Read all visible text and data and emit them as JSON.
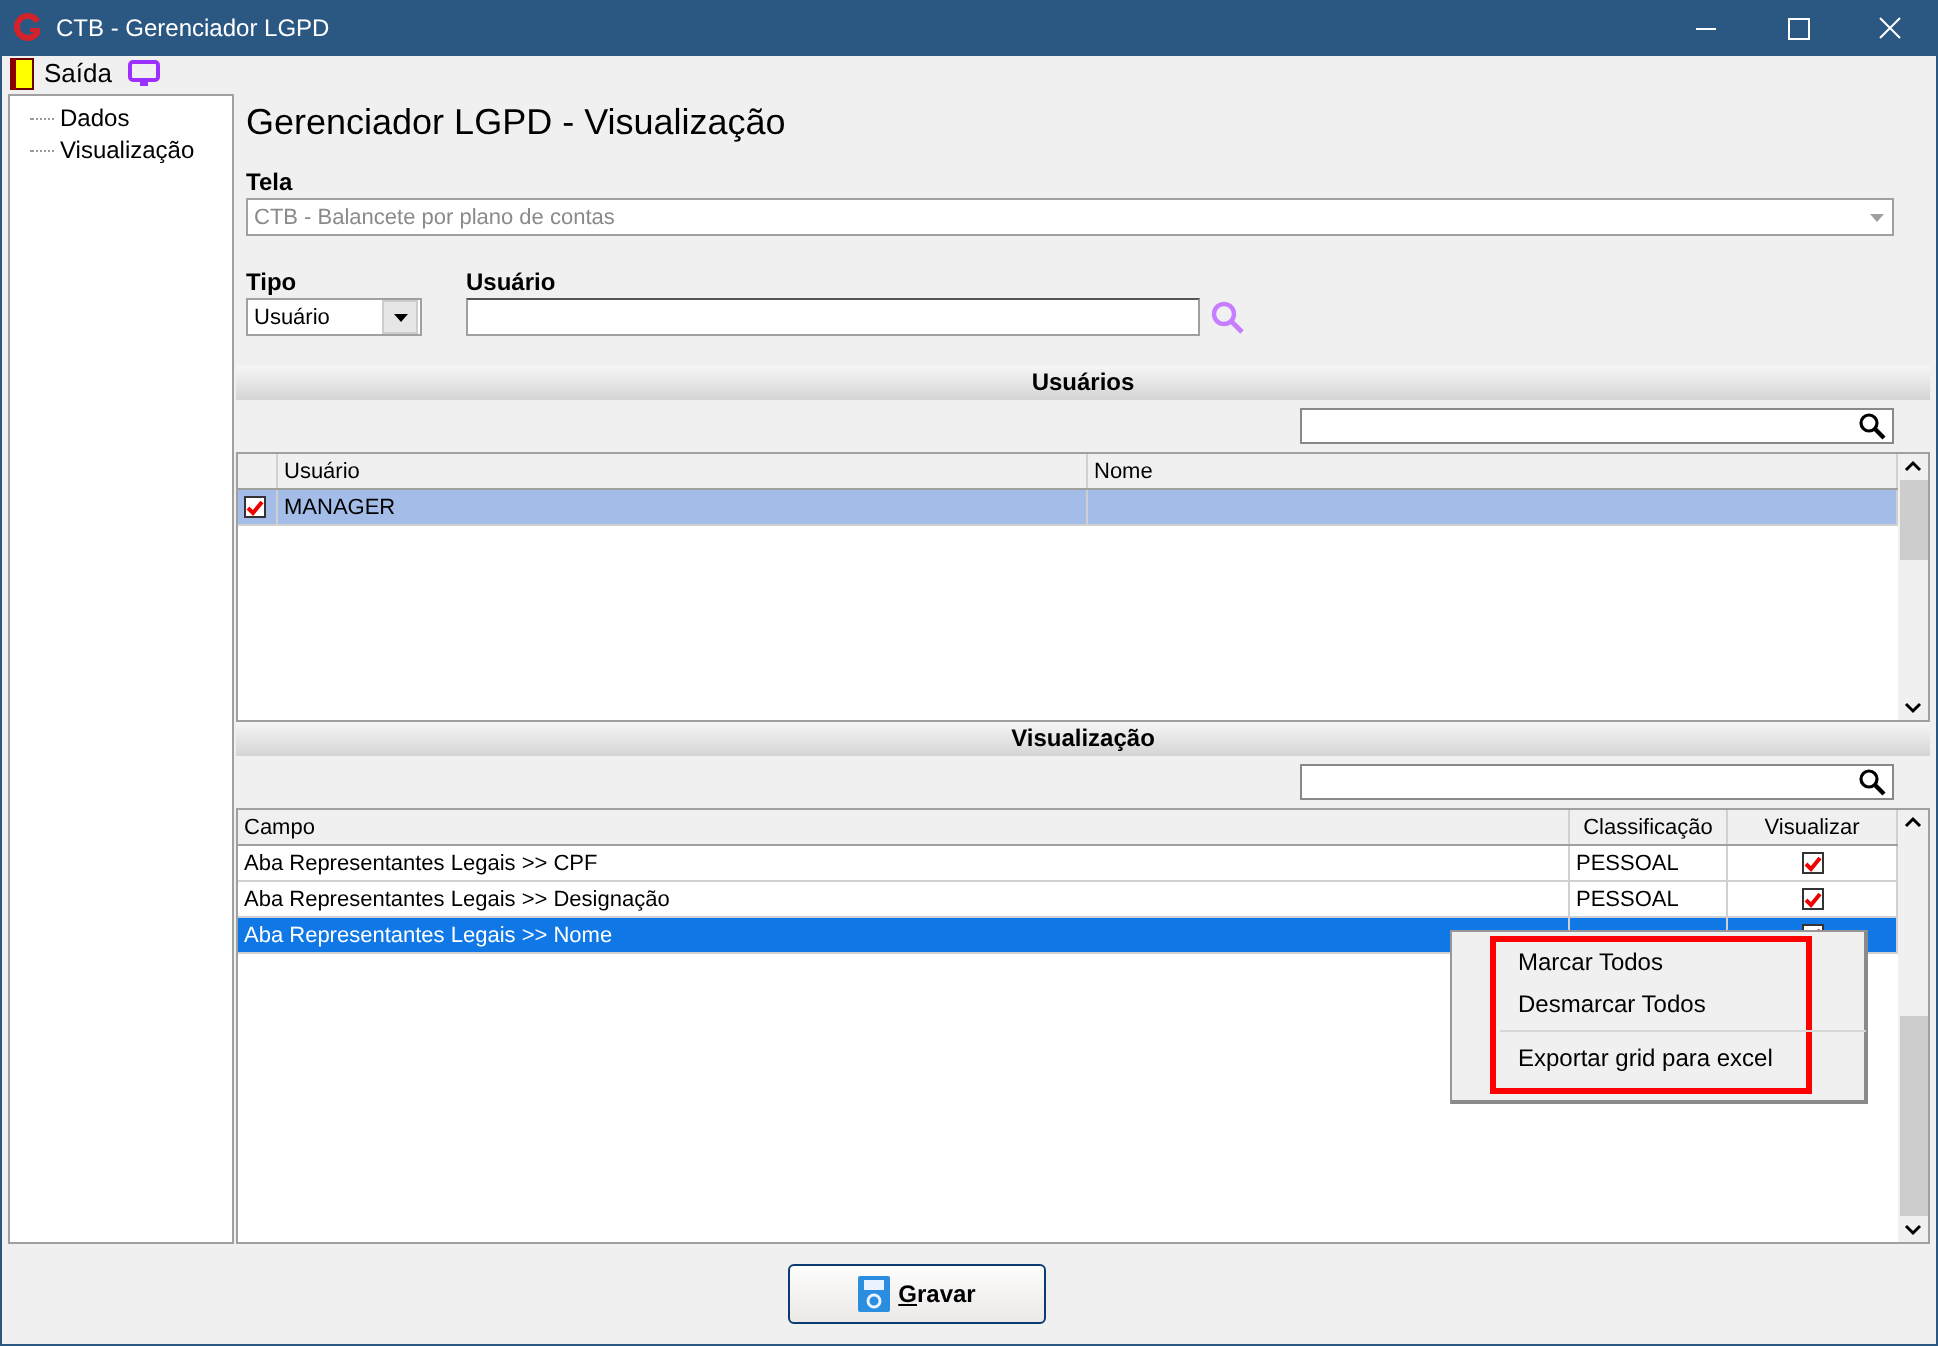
{
  "window": {
    "title": "CTB - Gerenciador LGPD"
  },
  "toolbar": {
    "exit_label": "Saída"
  },
  "sidebar": {
    "items": [
      {
        "label": "Dados"
      },
      {
        "label": "Visualização"
      }
    ]
  },
  "heading": "Gerenciador LGPD - Visualização",
  "tela": {
    "label": "Tela",
    "value": "CTB - Balancete por plano de contas",
    "disabled": true
  },
  "tipo": {
    "label": "Tipo",
    "value": "Usuário"
  },
  "usuario": {
    "label": "Usuário"
  },
  "users": {
    "title": "Usuários",
    "columns": [
      "Usuário",
      "Nome"
    ],
    "rows": [
      {
        "usuario": "MANAGER",
        "checked": true,
        "selected": true
      }
    ]
  },
  "visualizacao": {
    "title": "Visualização",
    "columns": [
      "Campo",
      "Classificação",
      "Visualizar"
    ],
    "rows": [
      {
        "campo": "Aba Representantes Legais >> CPF",
        "classificacao": "PESSOAL",
        "visualizar": true,
        "selected": false
      },
      {
        "campo": "Aba Representantes Legais >> Designação",
        "classificacao": "PESSOAL",
        "visualizar": true,
        "selected": false
      },
      {
        "campo": "Aba Representantes Legais >> Nome",
        "visualizar": true,
        "selected": true
      }
    ]
  },
  "context_menu": {
    "highlighted": true,
    "items": [
      {
        "kind": "item",
        "label": "Marcar Todos"
      },
      {
        "kind": "item",
        "label": "Desmarcar Todos"
      },
      {
        "kind": "separator"
      },
      {
        "kind": "item",
        "label": "Exportar grid para excel"
      }
    ]
  },
  "save_button": "Gravar"
}
